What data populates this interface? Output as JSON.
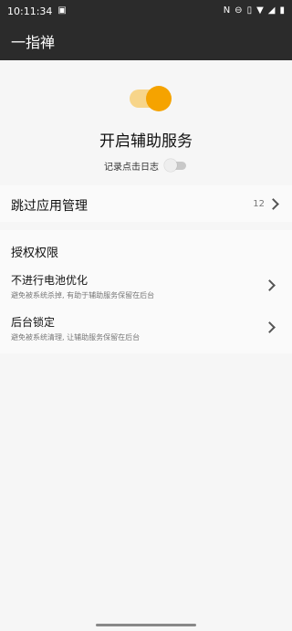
{
  "status_bar": {
    "time": "10:11:34",
    "icons": [
      "notification-badge-icon",
      "nfc-icon",
      "dnd-icon",
      "vibrate-icon",
      "wifi-icon",
      "signal-icon",
      "battery-icon"
    ]
  },
  "app_bar": {
    "title": "一指禅"
  },
  "hero": {
    "service_enabled": true,
    "title": "开启辅助服务",
    "log_label": "记录点击日志",
    "log_enabled": false
  },
  "skip": {
    "title": "跳过应用管理",
    "count": "12"
  },
  "permissions": {
    "section_title": "授权权限",
    "items": [
      {
        "title": "不进行电池优化",
        "desc": "避免被系统杀掉, 有助于辅助服务保留在后台"
      },
      {
        "title": "后台锁定",
        "desc": "避免被系统清理, 让辅助服务保留在后台"
      }
    ]
  },
  "colors": {
    "accent": "#f5a300",
    "appbar": "#2b2b2b",
    "background": "#f6f6f6"
  }
}
